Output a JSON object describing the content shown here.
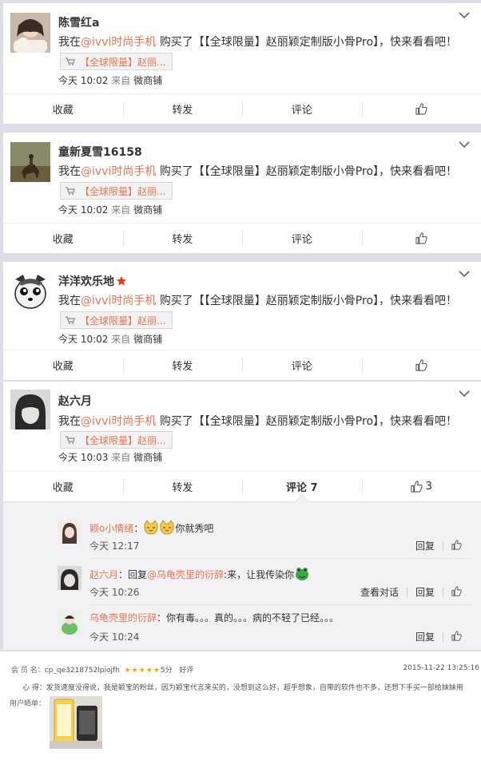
{
  "posts": [
    {
      "name": "陈雪红a",
      "content_prefix": "我在",
      "content_at": "@ivvi时尚手机",
      "content_suffix": " 购买了【【全球限量】赵丽颖定制版小骨Pro】，快来看看吧！",
      "product": "【全球限量】赵丽...",
      "time": "今天 10:02",
      "from_label": "来自",
      "source": "微商铺",
      "actions": {
        "fav": "收藏",
        "repost": "转发",
        "comment": "评论"
      }
    },
    {
      "name": "童新夏雪16158",
      "content_prefix": "我在",
      "content_at": "@ivvi时尚手机",
      "content_suffix": " 购买了【【全球限量】赵丽颖定制版小骨Pro】，快来看看吧！",
      "product": "【全球限量】赵丽...",
      "time": "今天 10:02",
      "from_label": "来自",
      "source": "微商铺",
      "actions": {
        "fav": "收藏",
        "repost": "转发",
        "comment": "评论"
      }
    },
    {
      "name": "洋洋欢乐地",
      "content_prefix": "我在",
      "content_at": "@ivvi时尚手机",
      "content_suffix": " 购买了【【全球限量】赵丽颖定制版小骨Pro】，快来看看吧！",
      "product": "【全球限量】赵丽...",
      "time": "今天 10:02",
      "from_label": "来自",
      "source": "微商铺",
      "actions": {
        "fav": "收藏",
        "repost": "转发",
        "comment": "评论"
      }
    },
    {
      "name": "赵六月",
      "content_prefix": "我在",
      "content_at": "@ivvi时尚手机",
      "content_suffix": " 购买了【【全球限量】赵丽颖定制版小骨Pro】，快来看看吧！",
      "product": "【全球限量】赵丽...",
      "time": "今天 10:03",
      "from_label": "来自",
      "source": "微商铺",
      "actions": {
        "fav": "收藏",
        "repost": "转发",
        "comment": "评论 7",
        "likes": "3"
      }
    }
  ],
  "comments": [
    {
      "user": "颖o小情绪",
      "sep": "：",
      "text": "你就秀吧",
      "time": "今天 12:17",
      "reply": "回复"
    },
    {
      "user": "赵六月",
      "sep": "：回复",
      "mention": "@乌龟壳里的衍辞",
      "text": ":来，让我传染你",
      "time": "今天 10:26",
      "view": "查看对话",
      "reply": "回复"
    },
    {
      "user": "乌龟壳里的衍辞",
      "sep": "：",
      "text": "你有毒。。。真的。。。病的不轻了已经。。。",
      "time": "今天 10:24",
      "reply": "回复"
    }
  ],
  "review": {
    "member_label": "会 员 名：",
    "member": "cp_qe3218752lpiojfh",
    "stars": "★★★★★",
    "score": "5分",
    "rating": "好评",
    "date": "2015-11-22 13:25:16",
    "feeling_label": "心 得：",
    "feeling": "发货速度没得说，我是颖宝的粉丝，因为颖宝代言来买的，没想到这么好，超乎想象，自带的软件也不多，还想下手买一部给妹妹用",
    "photo_label": "用户晒单："
  },
  "colors": {
    "accent": "#eb7350",
    "star": "#f7a600"
  }
}
